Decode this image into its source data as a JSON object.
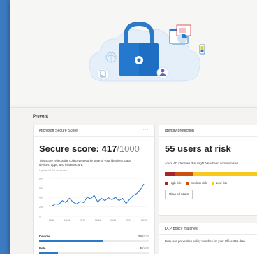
{
  "colors": {
    "page_bg": "#3c7bc2",
    "accent_blue": "#2c79c8",
    "high_risk": "#a4262c",
    "medium_risk": "#ca5010",
    "low_risk": "#f8c91e"
  },
  "hero": {
    "illustration_icons": [
      "padlock-icon",
      "cloud-icon",
      "laptop-icon",
      "phone-icon",
      "document-icon",
      "globe-icon"
    ]
  },
  "section": {
    "title": "Prevent"
  },
  "secure_score_card": {
    "title": "Microsoft Secure Score",
    "more": "···",
    "score_label": "Secure score: 417",
    "score_total": "/1000",
    "description": "This score reflects the collective security state of your identities, data, devices, apps, and infrastructure.",
    "updated": "Updated 4:20 am today",
    "chart_data": {
      "type": "line",
      "x": [
        "03/30",
        "03/06",
        "03/15",
        "03/16",
        "03/21",
        "03/24",
        "03/30"
      ],
      "y_ticks": [
        "800",
        "600",
        "400",
        "200",
        "0"
      ],
      "ylim": [
        0,
        800
      ],
      "series": [
        {
          "values": [
            210,
            260,
            250,
            330,
            290,
            380,
            300,
            260,
            310,
            290,
            400,
            370,
            440,
            300,
            380,
            330,
            390,
            350,
            400,
            330,
            380,
            270,
            360,
            440,
            480,
            560,
            680
          ]
        }
      ],
      "grid": true
    },
    "metrics": [
      {
        "label": "Devices",
        "value": "300",
        "max": "/520",
        "fraction": 0.58
      },
      {
        "label": "Data",
        "value": "40",
        "max": "/230",
        "fraction": 0.17
      }
    ]
  },
  "identity_card": {
    "title": "Identity protection",
    "more": "···",
    "headline": "55 users at risk",
    "description": "Azure AD identities that might have been compromised",
    "risk_distribution": [
      {
        "label": "High risk",
        "color": "#a4262c",
        "fraction": 0.1
      },
      {
        "label": "Medium risk",
        "color": "#ca5010",
        "fraction": 0.18
      },
      {
        "label": "Low risk",
        "color": "#f8c91e",
        "fraction": 0.72
      }
    ],
    "button": "View all users"
  },
  "dlp_card": {
    "title": "DLP policy matches",
    "more": "···",
    "description": "Data loss prevention policy matches for your Office 365 data"
  }
}
